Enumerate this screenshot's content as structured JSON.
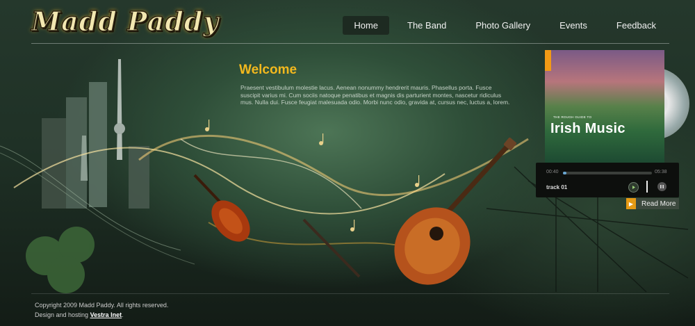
{
  "logo": {
    "text": "Madd Paddy"
  },
  "nav": {
    "items": [
      {
        "label": "Home"
      },
      {
        "label": "The Band"
      },
      {
        "label": "Photo Gallery"
      },
      {
        "label": "Events"
      },
      {
        "label": "Feedback"
      }
    ],
    "active": "Home"
  },
  "welcome": {
    "title": "Welcome",
    "text": "Praesent vestibulum molestie lacus. Aenean nonummy hendrerit mauris. Phasellus porta. Fusce suscipit varius mi. Cum sociis natoque penatibus et magnis dis parturient montes, nascetur ridiculus mus. Nulla dui. Fusce feugiat malesuada odio. Morbi nunc odio, gravida at, cursus nec, luctus a, lorem."
  },
  "album": {
    "guide_label": "THE ROUGH GUIDE TO",
    "title": "Irish Music"
  },
  "player": {
    "time_elapsed": "00:40",
    "time_total": "05:38",
    "progress": 0.04,
    "track": "track 01",
    "read_more": "Read More"
  },
  "footer": {
    "copyright": "Copyright 2009 Madd Paddy. All rights reserved.",
    "hosting_prefix": "Design and hosting",
    "hosting_link": "Vestra Inet",
    "hosting_suffix": "."
  },
  "colors": {
    "accent": "#f2b81e",
    "orange": "#e69a14",
    "nav_active_bg": "#1d2a21"
  }
}
